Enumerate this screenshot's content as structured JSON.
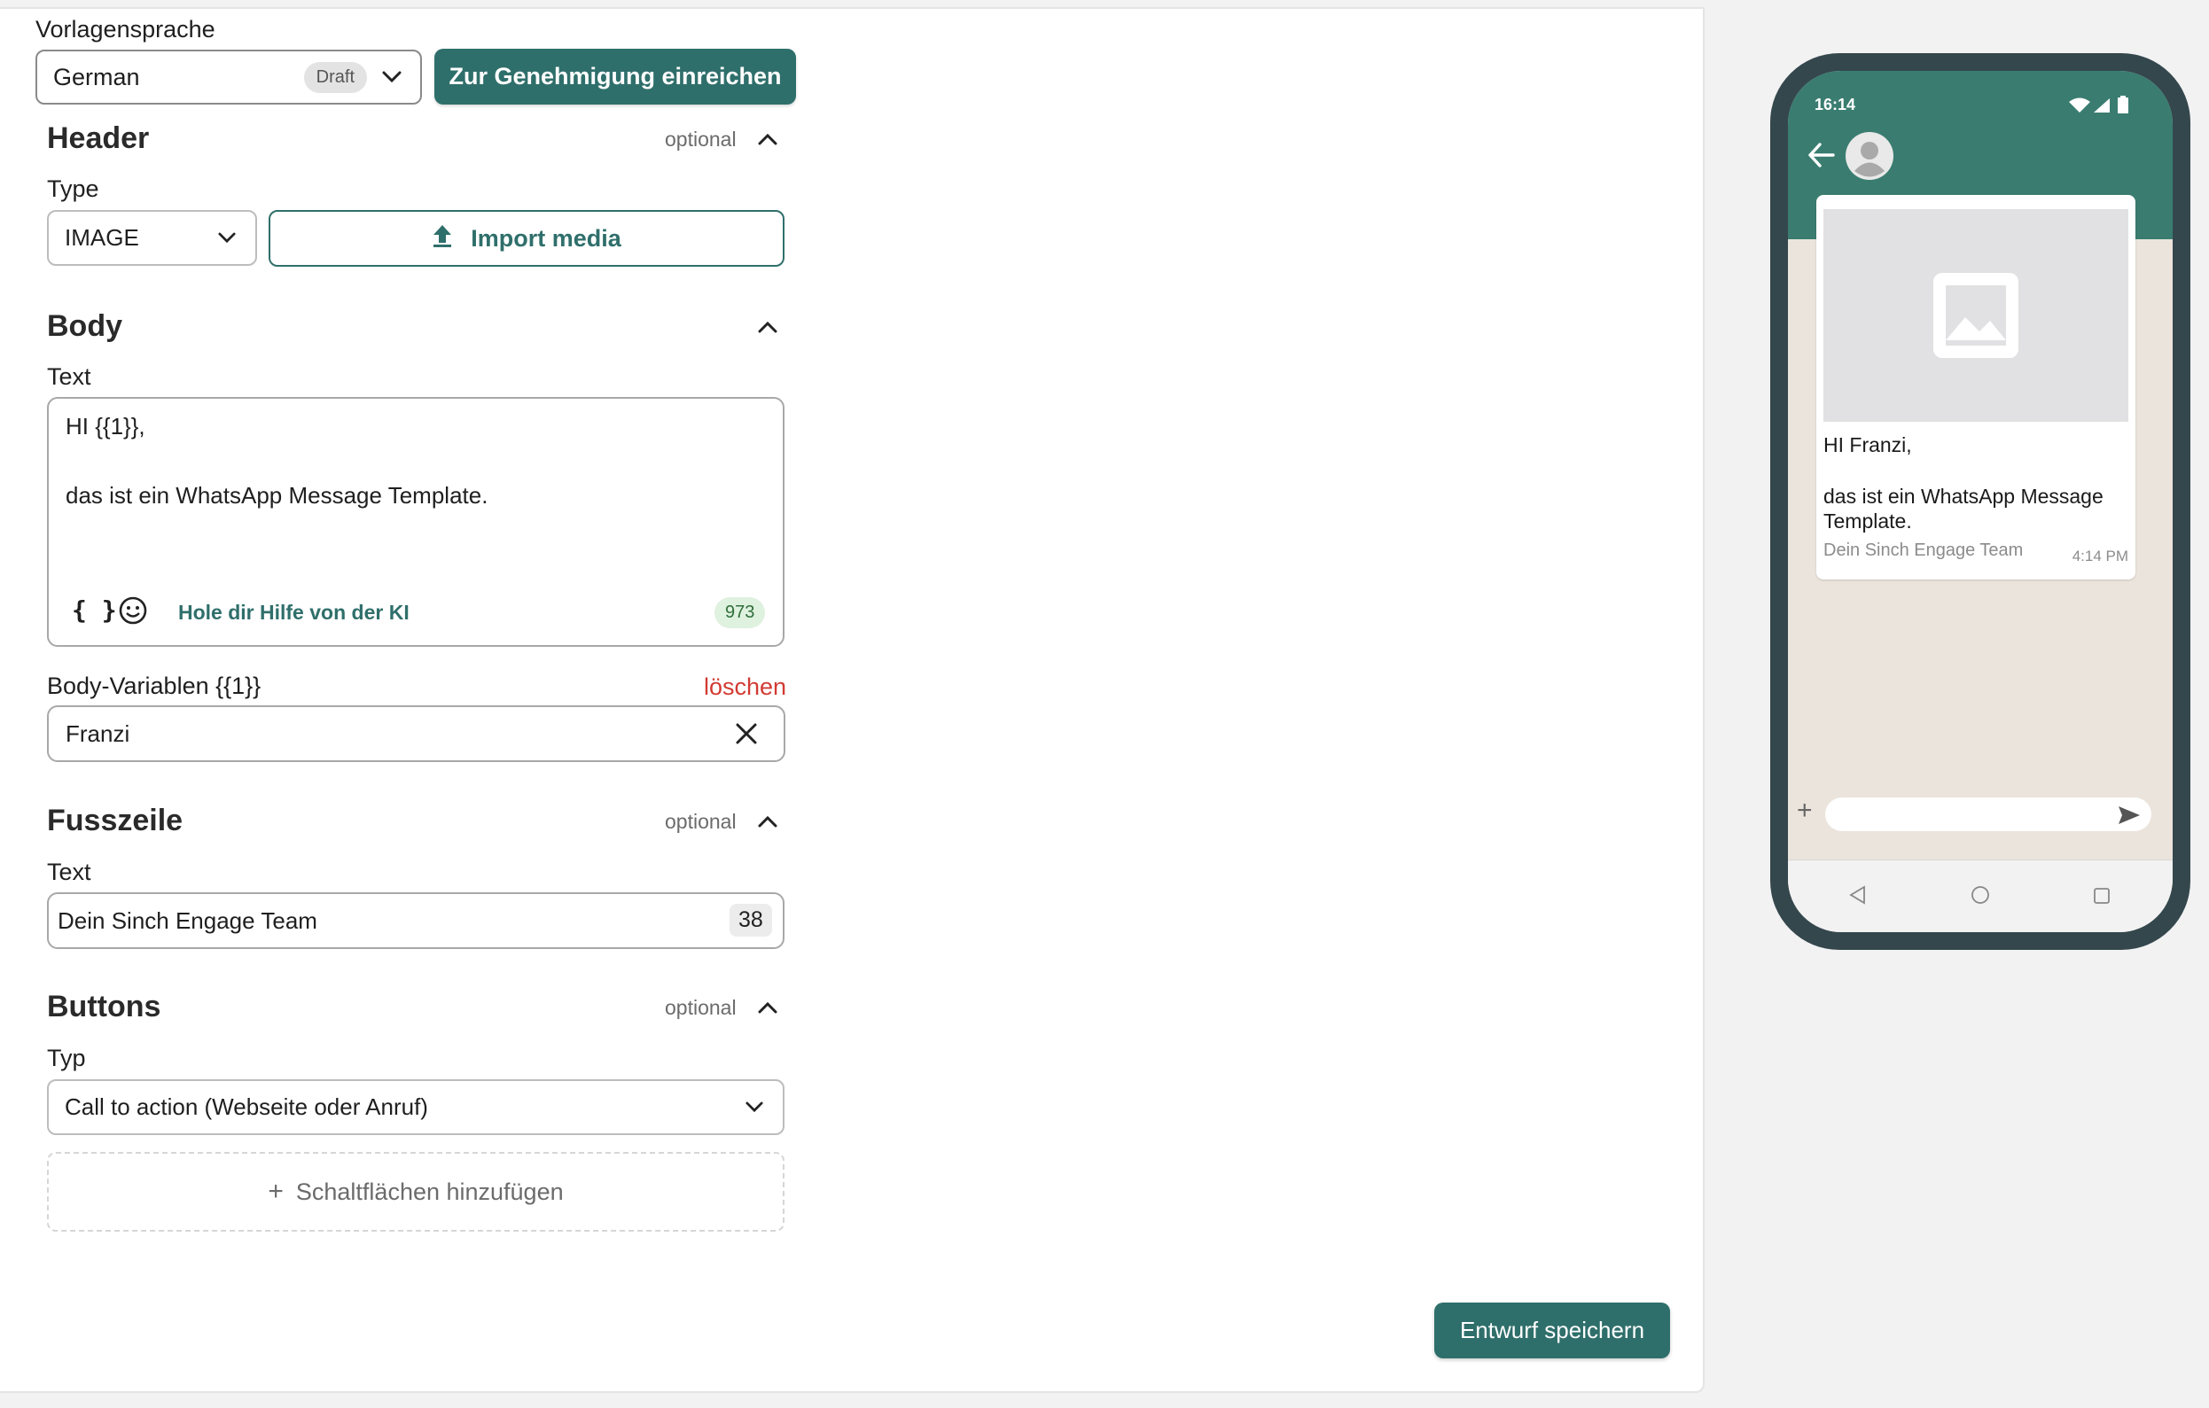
{
  "language": {
    "label": "Vorlagensprache",
    "selected": "German",
    "status_badge": "Draft",
    "submit_label": "Zur Genehmigung einreichen"
  },
  "header_section": {
    "title": "Header",
    "optional": "optional",
    "type_label": "Type",
    "type_value": "IMAGE",
    "import_label": "Import media"
  },
  "body_section": {
    "title": "Body",
    "text_label": "Text",
    "line1": "HI {{1}},",
    "line2": "das ist ein WhatsApp Message Template.",
    "variable_icon": "{ }",
    "ai_help": "Hole dir Hilfe von der KI",
    "char_count": "973",
    "variables_label": "Body-Variablen {{1}}",
    "delete_label": "löschen",
    "variable_value": "Franzi"
  },
  "footer_section": {
    "title": "Fusszeile",
    "optional": "optional",
    "text_label": "Text",
    "text_value": "Dein Sinch Engage Team",
    "char_count": "38"
  },
  "buttons_section": {
    "title": "Buttons",
    "optional": "optional",
    "type_label": "Typ",
    "type_value": "Call to action (Webseite oder Anruf)",
    "add_label": "Schaltflächen hinzufügen",
    "add_plus": "+"
  },
  "save_label": "Entwurf speichern",
  "preview": {
    "status_time": "16:14",
    "greeting": "HI Franzi,",
    "message_line1": "das ist ein WhatsApp Message",
    "message_line2": "Template.",
    "footer": "Dein Sinch Engage Team",
    "time": "4:14 PM",
    "composer_plus": "+"
  },
  "colors": {
    "primary": "#2f6f6b",
    "danger": "#d23a32",
    "whatsapp_header": "#3a7d70",
    "phone_frame": "#34474d",
    "chat_background": "#ebe4dc"
  },
  "icons": [
    "chevron-down-icon",
    "chevron-up-icon",
    "upload-icon",
    "emoji-icon",
    "close-icon",
    "plus-icon",
    "back-arrow-icon",
    "avatar-icon",
    "image-placeholder-icon",
    "send-icon",
    "wifi-icon",
    "signal-icon",
    "battery-icon"
  ]
}
